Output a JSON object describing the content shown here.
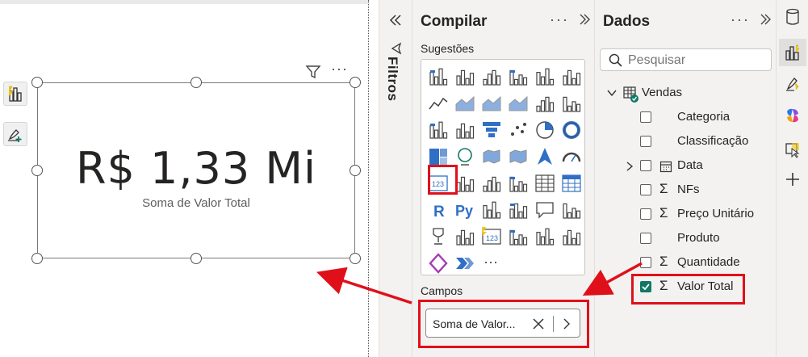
{
  "visual": {
    "value": "R$ 1,33 Mi",
    "label": "Soma de Valor Total"
  },
  "filters_strip": {
    "label": "Filtros"
  },
  "build_pane": {
    "title": "Compilar",
    "suggestions_label": "Sugestões",
    "more_icon": "ellipsis-icon",
    "collapse_icon": "double-chevron-right-icon",
    "gallery_icons": [
      "stacked-bar-icon",
      "stacked-column-icon",
      "clustered-bar-icon",
      "clustered-column-icon",
      "100-bar-icon",
      "100-column-icon",
      "line-icon",
      "area-icon",
      "stacked-area-icon",
      "100-area-icon",
      "line-column-icon",
      "line-clustered-icon",
      "ribbon-icon",
      "waterfall-icon",
      "funnel-icon",
      "scatter-icon",
      "pie-icon",
      "donut-icon",
      "treemap-icon",
      "map-icon",
      "filled-map-icon",
      "shape-map-icon",
      "azure-map-icon",
      "gauge-icon",
      "card-icon",
      "multirow-card-icon",
      "kpi-icon",
      "slicer-icon",
      "table-icon",
      "matrix-icon",
      "r-visual-icon",
      "python-visual-icon",
      "key-influencers-icon",
      "decomposition-tree-icon",
      "qa-icon",
      "smart-narrative-icon",
      "goals-icon",
      "paginated-report-icon",
      "card-new-icon",
      "power-automate-icon",
      "power-apps-icon",
      "arcgis-icon",
      "powerapps-icon",
      "more-visuals-icon",
      "ellipsis-icon"
    ],
    "python_label": "Py",
    "r_label": "R",
    "card_label": "123",
    "more_visuals_label": "···",
    "fields_label": "Campos",
    "field_chip": "Soma de Valor..."
  },
  "data_pane": {
    "title": "Dados",
    "search_placeholder": "Pesquisar",
    "table_name": "Vendas",
    "fields": [
      {
        "label": "Categoria",
        "sigma": false,
        "checked": false,
        "expand": false
      },
      {
        "label": "Classificação",
        "sigma": false,
        "checked": false,
        "expand": false
      },
      {
        "label": "Data",
        "sigma": false,
        "checked": false,
        "expand": true,
        "calendar": true
      },
      {
        "label": "NFs",
        "sigma": true,
        "checked": false,
        "expand": false
      },
      {
        "label": "Preço Unitário",
        "sigma": true,
        "checked": false,
        "expand": false
      },
      {
        "label": "Produto",
        "sigma": false,
        "checked": false,
        "expand": false
      },
      {
        "label": "Quantidade",
        "sigma": true,
        "checked": false,
        "expand": false
      },
      {
        "label": "Valor Total",
        "sigma": true,
        "checked": true,
        "expand": false
      }
    ]
  },
  "right_rail": {
    "buttons": [
      "database-icon",
      "build-visual-icon",
      "format-brush-icon",
      "copilot-icon",
      "select-pointer-icon",
      "add-icon"
    ]
  },
  "colors": {
    "annotation_red": "#e0101a",
    "checkbox_green": "#117865",
    "pane_bg": "#f3f2f1"
  }
}
